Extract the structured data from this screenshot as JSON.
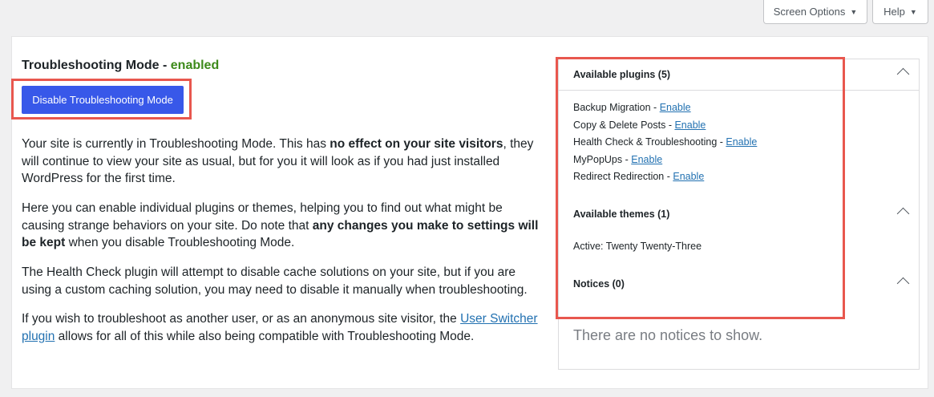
{
  "top_buttons": {
    "screen_options": "Screen Options",
    "help": "Help"
  },
  "left": {
    "title_prefix": "Troubleshooting Mode - ",
    "title_status": "enabled",
    "disable_button": "Disable Troubleshooting Mode",
    "p1_a": "Your site is currently in Troubleshooting Mode. This has ",
    "p1_b": "no effect on your site visitors",
    "p1_c": ", they will continue to view your site as usual, but for you it will look as if you had just installed WordPress for the first time.",
    "p2_a": "Here you can enable individual plugins or themes, helping you to find out what might be causing strange behaviors on your site. Do note that ",
    "p2_b": "any changes you make to settings will be kept",
    "p2_c": " when you disable Troubleshooting Mode.",
    "p3": "The Health Check plugin will attempt to disable cache solutions on your site, but if you are using a custom caching solution, you may need to disable it manually when troubleshooting.",
    "p4_a": "If you wish to troubleshoot as another user, or as an anonymous site visitor, the ",
    "p4_link": "User Switcher plugin",
    "p4_c": " allows for all of this while also being compatible with Troubleshooting Mode."
  },
  "side": {
    "plugins_header": "Available plugins (5)",
    "plugins": [
      {
        "name": "Backup Migration",
        "action": "Enable"
      },
      {
        "name": "Copy & Delete Posts",
        "action": "Enable"
      },
      {
        "name": "Health Check & Troubleshooting",
        "action": "Enable"
      },
      {
        "name": "MyPopUps",
        "action": "Enable"
      },
      {
        "name": "Redirect Redirection",
        "action": "Enable"
      }
    ],
    "separator": " - ",
    "themes_header": "Available themes (1)",
    "active_theme": "Active: Twenty Twenty-Three",
    "notices_header": "Notices (0)",
    "no_notices": "There are no notices to show."
  },
  "colors": {
    "primary_button": "#3858e9",
    "enabled_status": "#3d8a1a",
    "link": "#2271b1",
    "highlight": "#e8574e"
  }
}
